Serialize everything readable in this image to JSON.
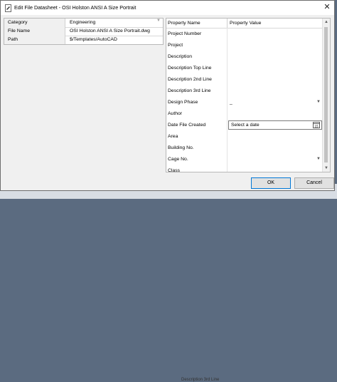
{
  "window": {
    "title": "Edit File Datasheet - OSI Holston ANSI A Size Portrait",
    "close_glyph": "✕"
  },
  "left_grid": {
    "rows": [
      {
        "label": "Category",
        "value": "Engineering",
        "has_dropdown": true
      },
      {
        "label": "File Name",
        "value": "OSI Holston ANSI A Size Portrait.dwg"
      },
      {
        "label": "Path",
        "value": "$/Templates/AutoCAD"
      }
    ]
  },
  "right_grid": {
    "header": {
      "col1": "Property Name",
      "col2": "Property Value"
    },
    "rows": [
      {
        "label": "Project Number",
        "value": ""
      },
      {
        "label": "Project",
        "value": ""
      },
      {
        "label": "Description",
        "value": ""
      },
      {
        "label": "Description Top Line",
        "value": ""
      },
      {
        "label": "Description 2nd Line",
        "value": ""
      },
      {
        "label": "Description 3rd Line",
        "value": ""
      },
      {
        "label": "Design Phase",
        "value": "_",
        "control": "select"
      },
      {
        "label": "Author",
        "value": ""
      },
      {
        "label": "Date File Created",
        "value": "Select a date",
        "control": "date",
        "calendar_day": "15"
      },
      {
        "label": "Area",
        "value": ""
      },
      {
        "label": "Building No.",
        "value": ""
      },
      {
        "label": "Cage No.",
        "value": "",
        "control": "select"
      },
      {
        "label": "Class",
        "value": ""
      }
    ]
  },
  "buttons": {
    "ok": "OK",
    "cancel": "Cancel"
  },
  "background": {
    "partial_text": "Description 3rd Line"
  },
  "colors": {
    "accent": "#0078d7",
    "window_bg": "#f0f0f0"
  },
  "icons": [
    "app-icon",
    "close-icon",
    "dropdown-arrow-icon",
    "calendar-icon",
    "scroll-up-icon",
    "scroll-down-icon"
  ]
}
